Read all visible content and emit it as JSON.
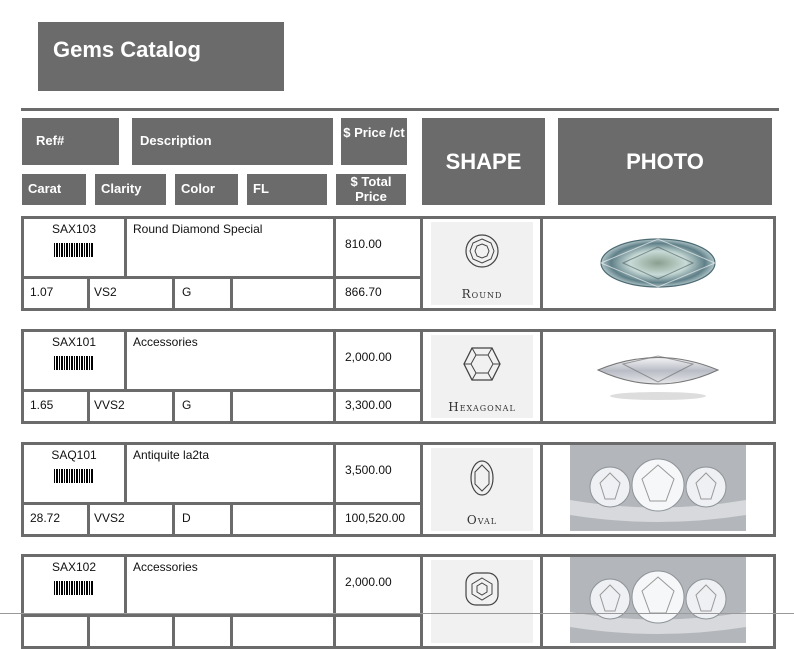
{
  "title": "Gems Catalog",
  "headers": {
    "ref": "Ref#",
    "description": "Description",
    "price_ct": "$ Price /ct",
    "carat": "Carat",
    "clarity": "Clarity",
    "color": "Color",
    "fl": "FL",
    "total_price": "$ Total Price",
    "shape": "SHAPE",
    "photo": "PHOTO"
  },
  "items": [
    {
      "ref": "SAX103",
      "description": "Round Diamond Special",
      "price_ct": "810.00",
      "carat": "1.07",
      "clarity": "VS2",
      "color": "G",
      "fl": "",
      "total": "866.70",
      "shape": "Round",
      "shape_icon": "round-diamond-icon",
      "photo": "oval-diamond-photo"
    },
    {
      "ref": "SAX101",
      "description": "Accessories",
      "price_ct": "2,000.00",
      "carat": "1.65",
      "clarity": "VVS2",
      "color": "G",
      "fl": "",
      "total": "3,300.00",
      "shape": "Hexagonal",
      "shape_icon": "hexagonal-diamond-icon",
      "photo": "marquise-diamond-photo"
    },
    {
      "ref": "SAQ101",
      "description": "Antiquite la2ta",
      "price_ct": "3,500.00",
      "carat": "28.72",
      "clarity": "VVS2",
      "color": "D",
      "fl": "",
      "total": "100,520.00",
      "shape": "Oval",
      "shape_icon": "oval-diamond-icon",
      "photo": "three-stone-ring-photo"
    },
    {
      "ref": "SAX102",
      "description": "Accessories",
      "price_ct": "2,000.00",
      "carat": "",
      "clarity": "",
      "color": "",
      "fl": "",
      "total": "",
      "shape": "",
      "shape_icon": "cushion-diamond-icon",
      "photo": "three-stone-ring-photo"
    }
  ]
}
